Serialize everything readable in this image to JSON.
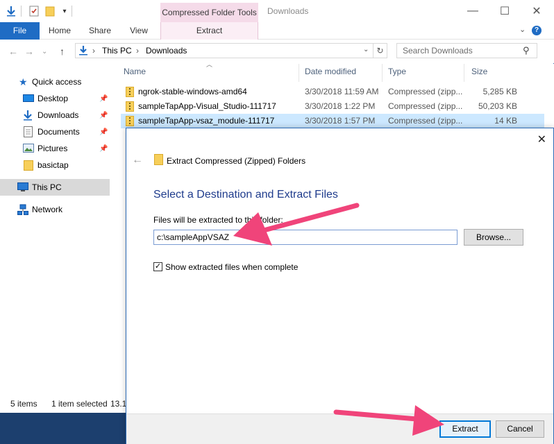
{
  "window": {
    "title": "Downloads",
    "context_tab": "Compressed Folder Tools"
  },
  "ribbon": {
    "tabs": [
      "File",
      "Home",
      "Share",
      "View",
      "Extract"
    ]
  },
  "address": {
    "path": [
      "This PC",
      "Downloads"
    ],
    "search_placeholder": "Search Downloads"
  },
  "nav": {
    "items": [
      {
        "label": "Quick access",
        "icon": "star-icon"
      },
      {
        "label": "Desktop",
        "icon": "desktop-icon",
        "pinned": true
      },
      {
        "label": "Downloads",
        "icon": "download-arrow-icon",
        "pinned": true
      },
      {
        "label": "Documents",
        "icon": "document-icon",
        "pinned": true
      },
      {
        "label": "Pictures",
        "icon": "picture-icon",
        "pinned": true
      },
      {
        "label": "basictap",
        "icon": "folder-icon"
      },
      {
        "label": "This PC",
        "icon": "computer-icon",
        "selected": true
      },
      {
        "label": "Network",
        "icon": "network-icon"
      }
    ]
  },
  "filelist": {
    "columns": [
      "Name",
      "Date modified",
      "Type",
      "Size"
    ],
    "rows": [
      {
        "name": "ngrok-stable-windows-amd64",
        "date": "3/30/2018 11:59 AM",
        "type": "Compressed (zipp...",
        "size": "5,285 KB"
      },
      {
        "name": "sampleTapApp-Visual_Studio-111717",
        "date": "3/30/2018 1:22 PM",
        "type": "Compressed (zipp...",
        "size": "50,203 KB"
      },
      {
        "name": "sampleTapApp-vsaz_module-111717",
        "date": "3/30/2018 1:57 PM",
        "type": "Compressed (zipp...",
        "size": "14 KB",
        "selected": true
      }
    ]
  },
  "status": {
    "items_count": "5 items",
    "selected": "1 item selected",
    "selected_size": "13.1"
  },
  "dialog": {
    "title": "Extract Compressed (Zipped) Folders",
    "heading": "Select a Destination and Extract Files",
    "folder_label": "Files will be extracted to this folder:",
    "destination": "c:\\sampleAppVSAZ",
    "browse_label": "Browse...",
    "show_files_label": "Show extracted files when complete",
    "show_files_checked": true,
    "extract_label": "Extract",
    "cancel_label": "Cancel"
  },
  "colors": {
    "file_tab": "#1f6cc4",
    "context_tab": "#f5dbe9",
    "selection": "#cce8ff",
    "heading": "#1e3b8c",
    "annotation_arrow": "#f0447a"
  }
}
